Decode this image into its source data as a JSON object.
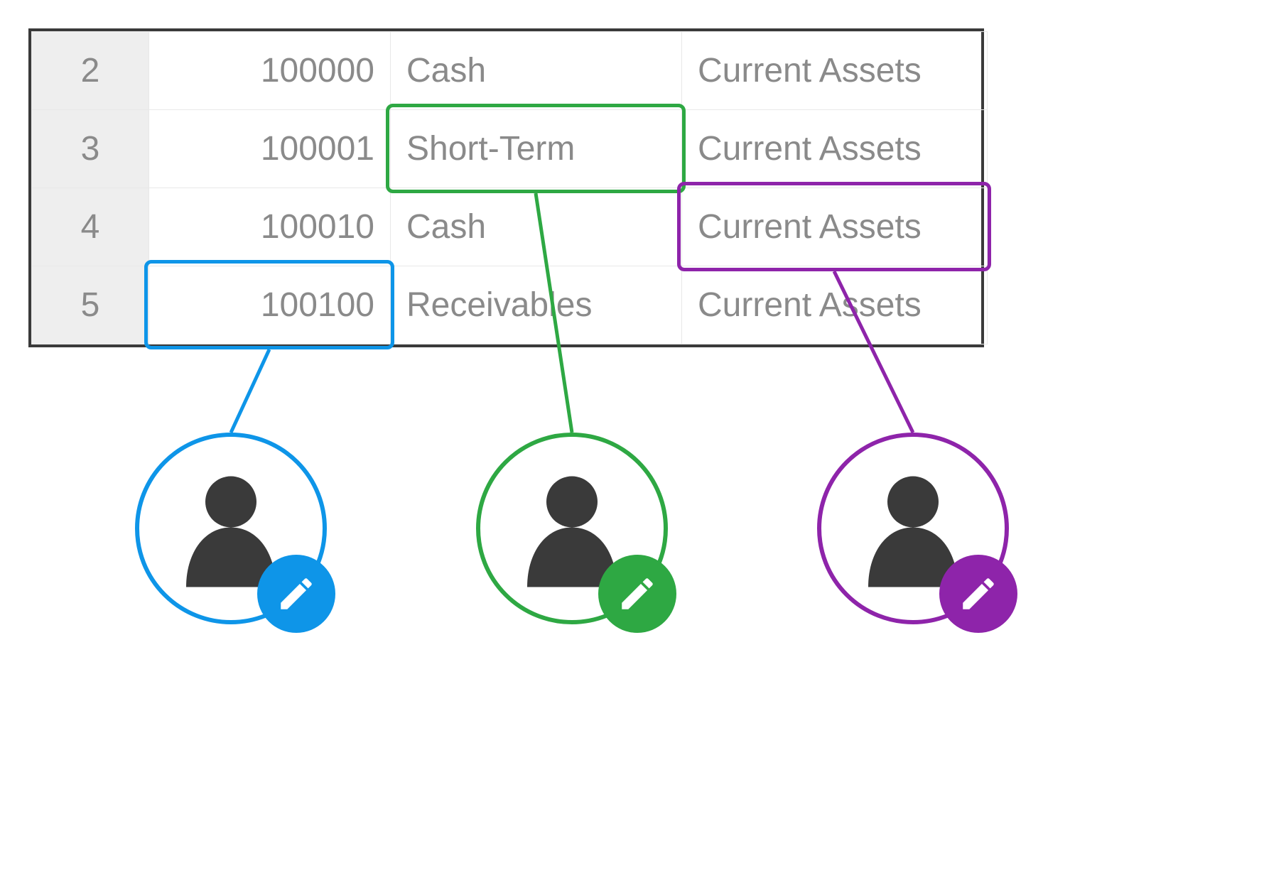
{
  "colors": {
    "blue": "#0e95e8",
    "green": "#2ea843",
    "purple": "#8e24aa"
  },
  "rows": [
    {
      "num": "2",
      "code": "100000",
      "name": "Cash",
      "cat": "Current Assets"
    },
    {
      "num": "3",
      "code": "100001",
      "name": "Short-Term",
      "cat": "Current Assets"
    },
    {
      "num": "4",
      "code": "100010",
      "name": "Cash",
      "cat": "Current Assets"
    },
    {
      "num": "5",
      "code": "100100",
      "name": "Receivables",
      "cat": "Current Assets"
    }
  ],
  "highlights": [
    {
      "id": "blue",
      "cell": {
        "row": 3,
        "col": "code"
      }
    },
    {
      "id": "green",
      "cell": {
        "row": 1,
        "col": "name"
      }
    },
    {
      "id": "purple",
      "cell": {
        "row": 2,
        "col": "cat"
      }
    }
  ],
  "avatars": [
    {
      "id": "blue"
    },
    {
      "id": "green"
    },
    {
      "id": "purple"
    }
  ]
}
